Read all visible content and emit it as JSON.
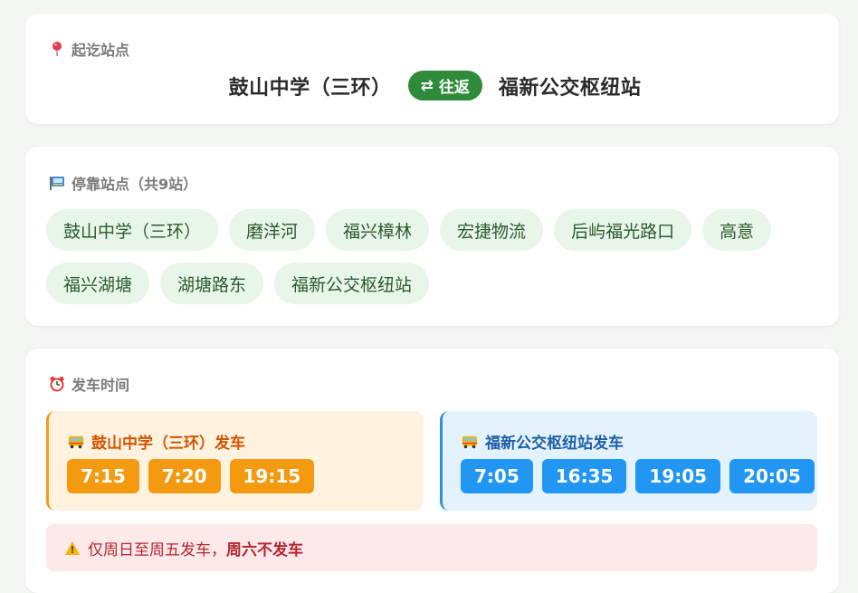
{
  "route": {
    "section_title": "起讫站点",
    "icon": "pushpin-icon",
    "start": "鼓山中学（三环）",
    "direction_label": "往返",
    "direction_symbol": "⇄",
    "end": "福新公交枢纽站"
  },
  "stops": {
    "section_title": "停靠站点（共9站）",
    "icon": "bus-stop-icon",
    "items": [
      "鼓山中学（三环）",
      "磨洋河",
      "福兴樟林",
      "宏捷物流",
      "后屿福光路口",
      "高意",
      "福兴湖塘",
      "湖塘路东",
      "福新公交枢纽站"
    ]
  },
  "times": {
    "section_title": "发车时间",
    "icon": "alarm-clock-icon",
    "from_start": {
      "title": "鼓山中学（三环）发车",
      "icon": "bus-icon",
      "departures": [
        "7:15",
        "7:20",
        "19:15"
      ]
    },
    "from_end": {
      "title": "福新公交枢纽站发车",
      "icon": "bus-icon",
      "departures": [
        "7:05",
        "16:35",
        "19:05",
        "20:05"
      ]
    },
    "notice": {
      "icon": "warning-icon",
      "text": "仅周日至周五发车，",
      "emphasis": "周六不发车"
    }
  },
  "colors": {
    "accent_green": "#2f8a3a",
    "stop_bg": "#e8f5e9",
    "orange": "#f39a11",
    "blue": "#2196f3",
    "notice_bg": "#fde8ea"
  }
}
